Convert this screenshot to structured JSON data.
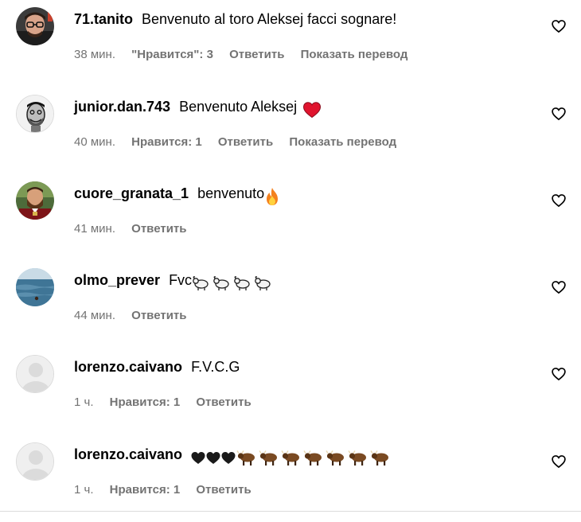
{
  "comments": [
    {
      "username": "71.tanito",
      "text": "Benvenuto al toro Aleksej facci sognare!",
      "time": "38 мин.",
      "likes": "\"Нравится\": 3",
      "reply": "Ответить",
      "translate": "Показать перевод",
      "avatar": "man-with-glasses"
    },
    {
      "username": "junior.dan.743",
      "text": "Benvenuto Aleksej",
      "emoji": "red-heart",
      "time": "40 мин.",
      "likes": "Нравится: 1",
      "reply": "Ответить",
      "translate": "Показать перевод",
      "avatar": "man-sketch"
    },
    {
      "username": "cuore_granata_1",
      "text": "benvenuto",
      "emoji": "fire",
      "time": "41 мин.",
      "reply": "Ответить",
      "avatar": "bearded-man-torino"
    },
    {
      "username": "olmo_prever",
      "text": "Fvc",
      "emoji": "ram x4",
      "time": "44 мин.",
      "reply": "Ответить",
      "avatar": "sea-photo"
    },
    {
      "username": "lorenzo.caivano",
      "text": "F.V.C.G",
      "time": "1 ч.",
      "likes": "Нравится: 1",
      "reply": "Ответить",
      "avatar": "default-gray"
    },
    {
      "username": "lorenzo.caivano",
      "text": "",
      "emoji": "black-heart x3, ox x7",
      "time": "1 ч.",
      "likes": "Нравится: 1",
      "reply": "Ответить",
      "avatar": "default-gray"
    }
  ],
  "colors": {
    "meta_gray": "#737373",
    "divider": "#dbdbdb",
    "default_avatar": "#dbdbdb"
  }
}
